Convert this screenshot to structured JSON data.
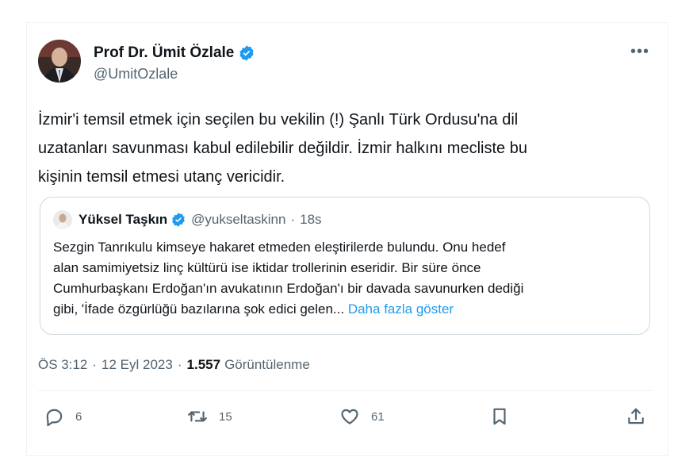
{
  "author": {
    "name": "Prof Dr. Ümit Özlale",
    "handle": "@UmitOzlale"
  },
  "more_label": "•••",
  "tweet_lines": [
    "İzmir'i temsil etmek için seçilen bu vekilin (!) Şanlı Türk Ordusu'na dil",
    "uzatanları savunması kabul edilebilir değildir. İzmir halkını mecliste bu",
    "kişinin temsil etmesi utanç vericidir."
  ],
  "quote": {
    "name": "Yüksel Taşkın",
    "handle": "@yukseltaskinn",
    "separator": "·",
    "age": "18s",
    "lines": [
      "Sezgin Tanrıkulu kimseye hakaret etmeden eleştirilerde bulundu. Onu hedef",
      "alan samimiyetsiz linç kültürü ise iktidar trollerinin eseridir. Bir süre önce",
      "Cumhurbaşkanı Erdoğan'ın avukatının Erdoğan'ı bir davada savunurken dediği",
      "gibi, 'İfade özgürlüğü bazılarına şok edici gelen..."
    ],
    "show_more": "Daha fazla göster"
  },
  "meta": {
    "time": "ÖS 3:12",
    "dot1": "·",
    "date": "12 Eyl 2023",
    "dot2": "·",
    "views": "1.557",
    "views_label": "Görüntülenme"
  },
  "actions": {
    "replies": "6",
    "reposts": "15",
    "likes": "61"
  },
  "colors": {
    "accent": "#1d9bf0",
    "muted": "#536471",
    "text": "#0f1419"
  },
  "icons": [
    "verified-badge-icon",
    "more-icon",
    "reply-icon",
    "repost-icon",
    "like-icon",
    "bookmark-icon",
    "share-icon"
  ]
}
